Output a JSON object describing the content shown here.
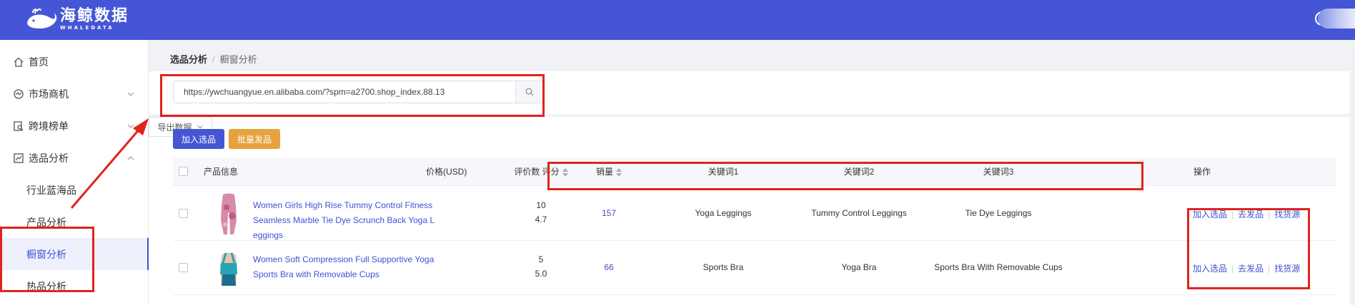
{
  "brand": {
    "name_cn": "海鲸数据",
    "name_en": "WHALEDATA"
  },
  "sidebar": {
    "items": [
      {
        "label": "首页",
        "icon": "home-icon"
      },
      {
        "label": "市场商机",
        "icon": "market-icon",
        "expandable": true
      },
      {
        "label": "跨境榜单",
        "icon": "ranking-icon",
        "expandable": true
      },
      {
        "label": "选品分析",
        "icon": "analysis-icon",
        "expanded": true
      }
    ],
    "subitems": [
      {
        "label": "行业蓝海品"
      },
      {
        "label": "产品分析"
      },
      {
        "label": "橱窗分析",
        "active": true
      },
      {
        "label": "热品分析"
      }
    ]
  },
  "breadcrumb": {
    "parent": "选品分析",
    "separator": "/",
    "current": "橱窗分析"
  },
  "search": {
    "value": "https://ywchuangyue.en.alibaba.com/?spm=a2700.shop_index.88.13"
  },
  "toolbar": {
    "add_label": "加入选品",
    "batch_label": "批量发品",
    "export_label": "导出数据"
  },
  "table": {
    "headers": {
      "product": "产品信息",
      "price": "价格(USD)",
      "reviews": "评价数 评分",
      "sales": "销量",
      "kw1": "关键词1",
      "kw2": "关键词2",
      "kw3": "关键词3",
      "ops": "操作"
    },
    "rows": [
      {
        "title": "Women Girls High Rise Tummy Control Fitness Seamless Marble Tie Dye Scrunch Back Yoga Leggings",
        "reviews": "10",
        "rating": "4.7",
        "sales": "157",
        "kw1": "Yoga Leggings",
        "kw2": "Tummy Control Leggings",
        "kw3": "Tie Dye Leggings",
        "ops": [
          "加入选品",
          "去发品",
          "找货源"
        ]
      },
      {
        "title": "Women Soft Compression Full Supportive Yoga Sports Bra with Removable Cups",
        "reviews": "5",
        "rating": "5.0",
        "sales": "66",
        "kw1": "Sports Bra",
        "kw2": "Yoga Bra",
        "kw3": "Sports Bra With Removable Cups",
        "ops": [
          "加入选品",
          "去发品",
          "找货源"
        ]
      }
    ]
  },
  "colors": {
    "primary": "#4456d6",
    "warning": "#e6a23c",
    "annotation": "#e0231c"
  }
}
